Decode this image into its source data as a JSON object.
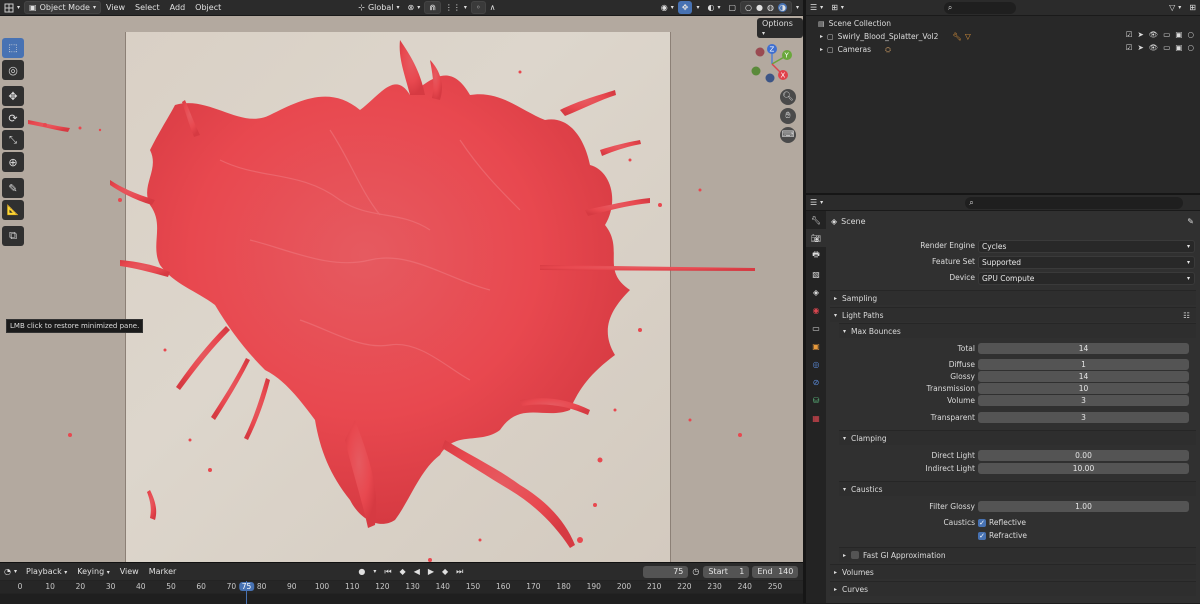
{
  "viewport": {
    "mode_label": "Object Mode",
    "menus": [
      "View",
      "Select",
      "Add",
      "Object"
    ],
    "orientation_label": "Global",
    "options_label": "Options",
    "tooltip": "LMB click to restore minimized pane.",
    "gizmo_axes": [
      "X",
      "Y",
      "Z"
    ]
  },
  "timeline": {
    "menus": [
      "Playback",
      "Keying",
      "View",
      "Marker"
    ],
    "current_frame": "75",
    "start_label": "Start",
    "start_value": "1",
    "end_label": "End",
    "end_value": "140",
    "ticks": [
      "0",
      "10",
      "20",
      "30",
      "40",
      "50",
      "60",
      "70",
      "75",
      "80",
      "90",
      "100",
      "110",
      "120",
      "130",
      "140",
      "150",
      "160",
      "170",
      "180",
      "190",
      "200",
      "210",
      "220",
      "230",
      "240",
      "250"
    ]
  },
  "outliner": {
    "root": "Scene Collection",
    "items": [
      {
        "label": "Swirly_Blood_Splatter_Vol2"
      },
      {
        "label": "Cameras"
      }
    ]
  },
  "properties": {
    "title": "Scene",
    "render_engine_label": "Render Engine",
    "render_engine_value": "Cycles",
    "feature_set_label": "Feature Set",
    "feature_set_value": "Supported",
    "device_label": "Device",
    "device_value": "GPU Compute",
    "sampling_label": "Sampling",
    "light_paths_label": "Light Paths",
    "max_bounces_label": "Max Bounces",
    "bounces": [
      {
        "label": "Total",
        "value": "14"
      },
      {
        "label": "Diffuse",
        "value": "1"
      },
      {
        "label": "Glossy",
        "value": "14"
      },
      {
        "label": "Transmission",
        "value": "10"
      },
      {
        "label": "Volume",
        "value": "3"
      },
      {
        "label": "Transparent",
        "value": "3"
      }
    ],
    "clamping_label": "Clamping",
    "direct_light_label": "Direct Light",
    "direct_light_value": "0.00",
    "indirect_light_label": "Indirect Light",
    "indirect_light_value": "10.00",
    "caustics_label": "Caustics",
    "filter_glossy_label": "Filter Glossy",
    "filter_glossy_value": "1.00",
    "caustics_row_label": "Caustics",
    "reflective_label": "Reflective",
    "refractive_label": "Refractive",
    "fast_gi_label": "Fast GI Approximation",
    "volumes_label": "Volumes",
    "curves_label": "Curves"
  },
  "colors": {
    "accent": "#4772b3",
    "splatter": "#e8484f",
    "playhead": "#4772b3"
  }
}
